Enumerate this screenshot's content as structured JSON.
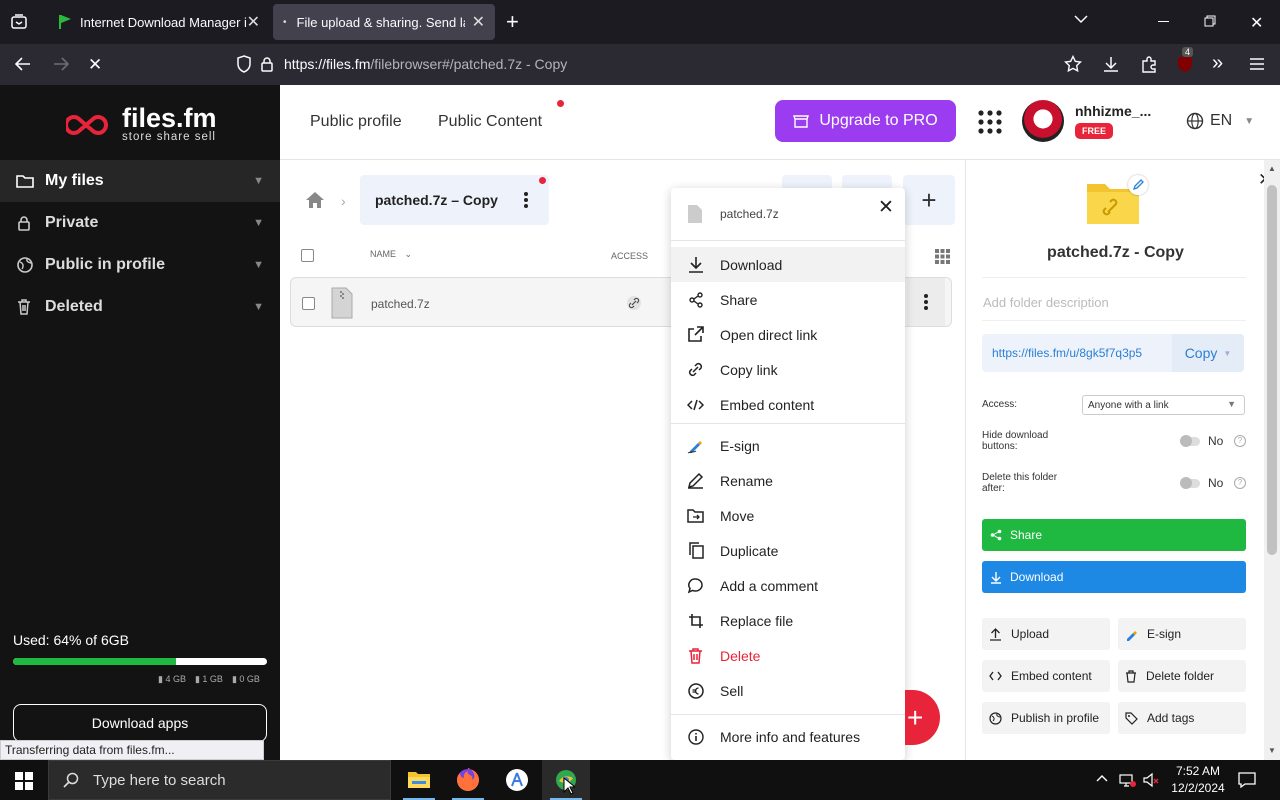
{
  "browser": {
    "tabs": [
      {
        "title": "Internet Download Manager is",
        "active": false
      },
      {
        "title": "File upload & sharing. Send larg",
        "active": true
      }
    ],
    "url_host": "https://files.fm",
    "url_path": "/filebrowser#/patched.7z - Copy",
    "extension_badge": "4"
  },
  "logo": {
    "name": "files.fm",
    "tagline": "store share sell"
  },
  "sidebar": {
    "items": [
      {
        "label": "My files",
        "icon": "folder-icon"
      },
      {
        "label": "Private",
        "icon": "lock-icon"
      },
      {
        "label": "Public in profile",
        "icon": "globe-icon"
      },
      {
        "label": "Deleted",
        "icon": "trash-icon"
      }
    ],
    "storage_label": "Used: 64% of 6GB",
    "storage_used_fraction": 0.64,
    "legend": [
      "4 GB",
      "1 GB",
      "0 GB"
    ],
    "download_apps": "Download apps"
  },
  "status_text": "Transferring data from files.fm...",
  "header": {
    "public_profile": "Public profile",
    "public_content": "Public Content",
    "upgrade": "Upgrade to PRO",
    "username": "nhhizme_...",
    "plan_badge": "FREE",
    "language": "EN"
  },
  "browser_area": {
    "breadcrumb_folder": "patched.7z – Copy",
    "col_name": "NAME",
    "col_access": "ACCESS",
    "file_name": "patched.7z"
  },
  "context_menu": {
    "file_name": "patched.7z",
    "items": [
      {
        "label": "Download"
      },
      {
        "label": "Share"
      },
      {
        "label": "Open direct link"
      },
      {
        "label": "Copy link"
      },
      {
        "label": "Embed content"
      },
      {
        "label": "E-sign"
      },
      {
        "label": "Rename"
      },
      {
        "label": "Move"
      },
      {
        "label": "Duplicate"
      },
      {
        "label": "Add a comment"
      },
      {
        "label": "Replace file"
      },
      {
        "label": "Delete"
      },
      {
        "label": "Sell"
      },
      {
        "label": "More info and features"
      }
    ]
  },
  "right_panel": {
    "title": "patched.7z - Copy",
    "description_placeholder": "Add folder description",
    "link": "https://files.fm/u/8gk5f7q3p5",
    "copy": "Copy",
    "access_label": "Access:",
    "access_value": "Anyone with a link",
    "hide_download_label": "Hide download buttons:",
    "hide_download_value": "No",
    "delete_after_label": "Delete this folder after:",
    "delete_after_value": "No",
    "share": "Share",
    "download": "Download",
    "actions": [
      "Upload",
      "E-sign",
      "Embed content",
      "Delete folder",
      "Publish in profile",
      "Add tags"
    ]
  },
  "taskbar": {
    "search_placeholder": "Type here to search",
    "time": "7:52 AM",
    "date": "12/2/2024"
  },
  "colors": {
    "accent_purple": "#9b3cf0",
    "share_green": "#1fb941",
    "download_blue": "#1e88e5",
    "danger_red": "#e8243a"
  }
}
